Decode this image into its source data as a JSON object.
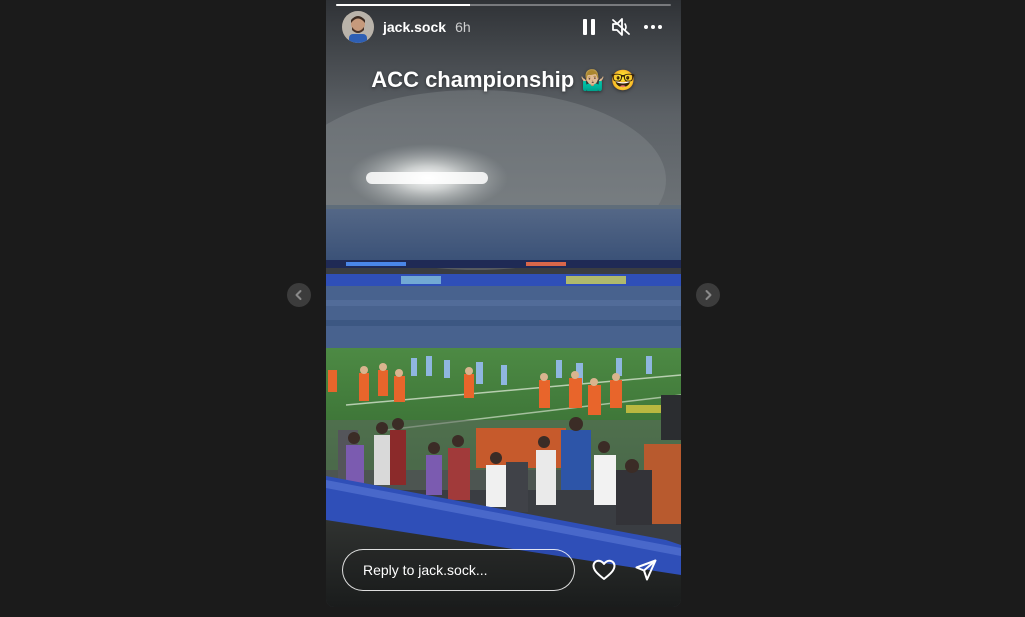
{
  "story": {
    "username": "jack.sock",
    "time_ago": "6h",
    "caption": "ACC championship",
    "caption_emojis": "🤷🏼‍♂️ 🤓",
    "progress": 0.4,
    "reply_placeholder": "Reply to jack.sock...",
    "icons": {
      "pause": "pause-icon",
      "mute": "speaker-muted-icon",
      "more": "more-options-icon",
      "like": "heart-icon",
      "share": "send-icon",
      "prev": "chevron-left-icon",
      "next": "chevron-right-icon"
    }
  },
  "colors": {
    "page_background": "#1b1b1b",
    "field_green": "#3f7d3b",
    "crowd_blue": "#3e5a86",
    "clemson_orange": "#e8652b",
    "ribbon_blue": "#2f4fb8"
  }
}
